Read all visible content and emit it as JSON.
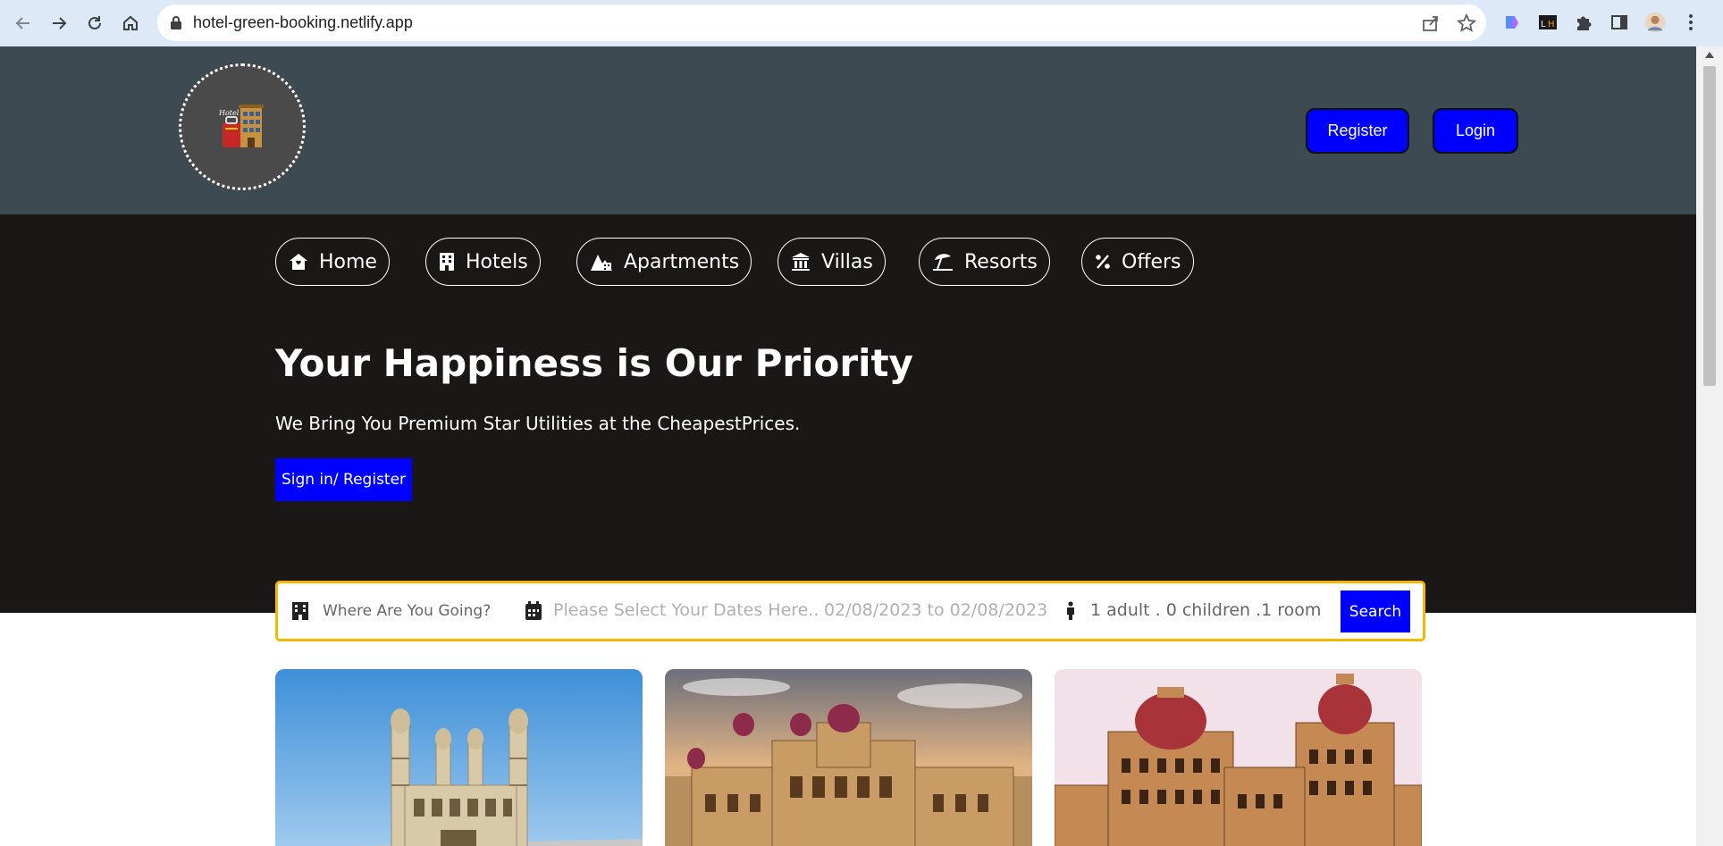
{
  "browser": {
    "url": "hotel-green-booking.netlify.app",
    "back_icon": "arrow-left-icon",
    "forward_icon": "arrow-right-icon",
    "reload_icon": "reload-icon",
    "home_icon": "home-icon"
  },
  "header": {
    "logo_icon": "hotel-logo",
    "register_label": "Register",
    "login_label": "Login"
  },
  "nav": {
    "items": [
      {
        "label": "Home",
        "icon": "house-icon"
      },
      {
        "label": "Hotels",
        "icon": "building-icon"
      },
      {
        "label": "Apartments",
        "icon": "apartments-icon"
      },
      {
        "label": "Villas",
        "icon": "villa-icon"
      },
      {
        "label": "Resorts",
        "icon": "umbrella-beach-icon"
      },
      {
        "label": "Offers",
        "icon": "percent-icon"
      }
    ]
  },
  "hero": {
    "title": "Your Happiness is Our Priority",
    "subtitle": "We Bring You Premium Star Utilities at the CheapestPrices.",
    "cta_label": "Sign in/ Register"
  },
  "search": {
    "destination_placeholder": "Where Are You Going?",
    "dates_placeholder": "Please Select Your Dates Here..",
    "dates_value": "02/08/2023 to 02/08/2023",
    "guests_value": "1 adult . 0 children .1 room",
    "search_label": "Search"
  },
  "colors": {
    "header_bg": "#3e4a52",
    "hero_bg": "#1b1717",
    "accent_blue": "#0000ff",
    "search_border": "#f5b800"
  }
}
